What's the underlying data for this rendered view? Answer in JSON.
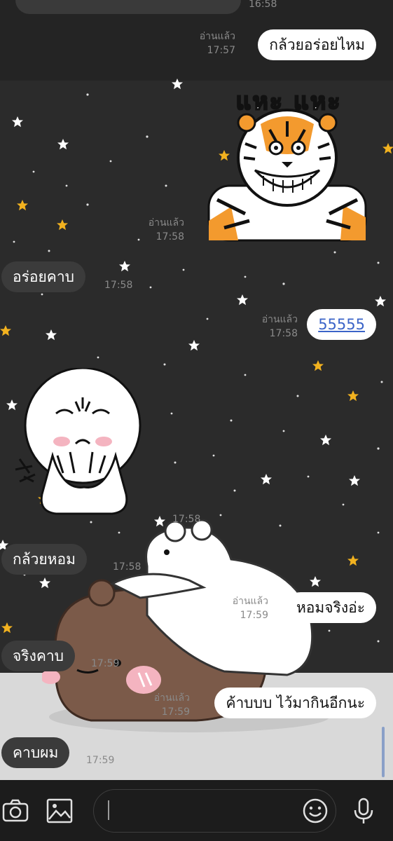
{
  "colors": {
    "background": "#2b2b2b",
    "incoming_bubble": "#3b3b3b",
    "outgoing_bubble": "#ffffff",
    "link_text": "#3b64c8",
    "meta_text": "#8a8a8a",
    "star_white": "#ffffff",
    "star_gold": "#f2b21f",
    "bottom_bar": "#1c1c1c"
  },
  "previous": {
    "time": "16:58"
  },
  "messages": [
    {
      "side": "out",
      "text": "กล้วยอร่อยไหม",
      "read": "อ่านแล้ว",
      "time": "17:57"
    },
    {
      "side": "out",
      "sticker": "tiger-laughing-sticker",
      "sticker_text": "แหะ แหะ",
      "read": "อ่านแล้ว",
      "time": "17:58"
    },
    {
      "side": "in",
      "text": "อร่อยคาบ",
      "time": "17:58"
    },
    {
      "side": "out",
      "text": "55555",
      "read": "อ่านแล้ว",
      "time": "17:58"
    },
    {
      "side": "in",
      "sticker": "moon-face-sticker",
      "time": "17:58"
    },
    {
      "side": "in",
      "text": "กล้วยหอม",
      "time": "17:58"
    },
    {
      "side": "out",
      "text": "หอมจริงอ่ะ",
      "read": "อ่านแล้ว",
      "time": "17:59"
    },
    {
      "side": "in",
      "text": "จริงคาบ",
      "time": "17:59"
    },
    {
      "side": "out",
      "text": "ค้าบบบ ไว้มากินอีกนะ",
      "read": "อ่านแล้ว",
      "time": "17:59"
    },
    {
      "side": "in",
      "text": "คาบผม",
      "time": "17:59"
    }
  ],
  "bottom_bar": {
    "icons": [
      "camera-icon",
      "image-icon",
      "emoji-icon",
      "microphone-icon"
    ],
    "input_value": ""
  }
}
